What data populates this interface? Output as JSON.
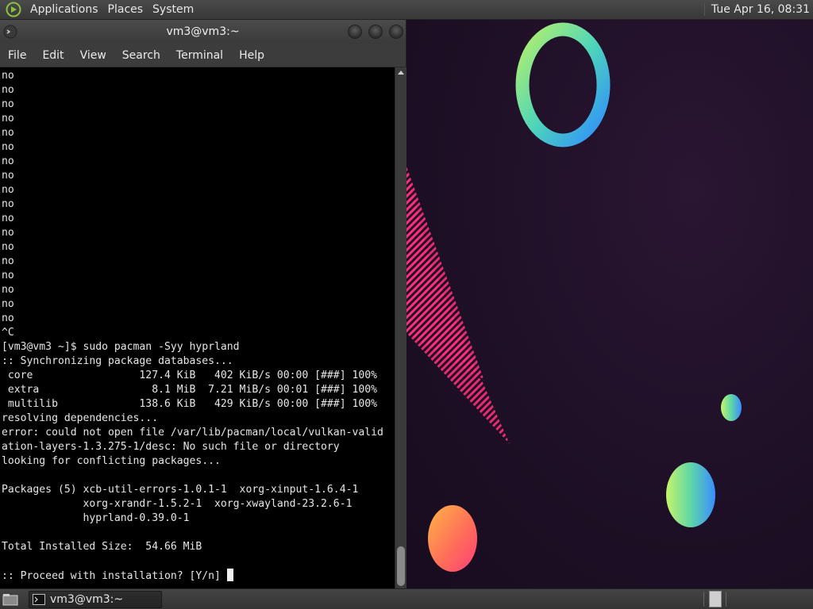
{
  "top_panel": {
    "menus": [
      "Applications",
      "Places",
      "System"
    ],
    "clock": "Tue Apr 16, 08:31"
  },
  "window": {
    "title": "vm3@vm3:~",
    "menu": [
      "File",
      "Edit",
      "View",
      "Search",
      "Terminal",
      "Help"
    ]
  },
  "terminal": {
    "lines": [
      "no",
      "no",
      "no",
      "no",
      "no",
      "no",
      "no",
      "no",
      "no",
      "no",
      "no",
      "no",
      "no",
      "no",
      "no",
      "no",
      "no",
      "no",
      "^C",
      "[vm3@vm3 ~]$ sudo pacman -Syy hyprland",
      ":: Synchronizing package databases...",
      " core                 127.4 KiB   402 KiB/s 00:00 [###] 100%",
      " extra                  8.1 MiB  7.21 MiB/s 00:01 [###] 100%",
      " multilib             138.6 KiB   429 KiB/s 00:00 [###] 100%",
      "resolving dependencies...",
      "error: could not open file /var/lib/pacman/local/vulkan-valid",
      "ation-layers-1.3.275-1/desc: No such file or directory",
      "looking for conflicting packages...",
      "",
      "Packages (5) xcb-util-errors-1.0.1-1  xorg-xinput-1.6.4-1",
      "             xorg-xrandr-1.5.2-1  xorg-xwayland-23.2.6-1",
      "             hyprland-0.39.0-1",
      "",
      "Total Installed Size:  54.66 MiB",
      ""
    ],
    "prompt": ":: Proceed with installation? [Y/n] "
  },
  "taskbar": {
    "task_label": "vm3@vm3:~"
  },
  "colors": {
    "wallpaper": "#1d0f25",
    "terminal_bg": "#000000",
    "terminal_fg": "#e6e6e6",
    "panel": "#3a3a3a"
  }
}
